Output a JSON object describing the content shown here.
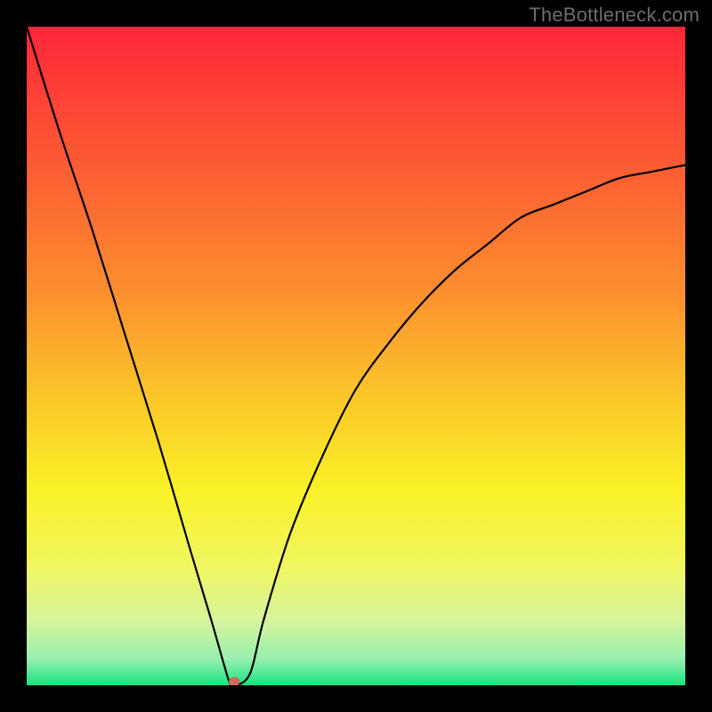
{
  "watermark": "TheBottleneck.com",
  "colors": {
    "gradient_stops": [
      {
        "offset": 0.0,
        "color": "#fe2639"
      },
      {
        "offset": 0.2,
        "color": "#fd5933"
      },
      {
        "offset": 0.4,
        "color": "#fc8e2f"
      },
      {
        "offset": 0.55,
        "color": "#fbc22a"
      },
      {
        "offset": 0.7,
        "color": "#faf126"
      },
      {
        "offset": 0.82,
        "color": "#f0f661"
      },
      {
        "offset": 0.9,
        "color": "#d7f49a"
      },
      {
        "offset": 0.96,
        "color": "#98efb1"
      },
      {
        "offset": 1.0,
        "color": "#18e480"
      }
    ],
    "curve": "#000000",
    "dot": "#d36a5e",
    "frame": "#000000"
  },
  "chart_data": {
    "type": "line",
    "title": "",
    "xlabel": "",
    "ylabel": "",
    "xlim": [
      0,
      100
    ],
    "ylim": [
      0,
      100
    ],
    "grid": false,
    "legend": false,
    "series": [
      {
        "name": "bottleneck-v-curve",
        "x": [
          0,
          5,
          10,
          15,
          20,
          25,
          28,
          30,
          31,
          32,
          34,
          36,
          40,
          45,
          50,
          55,
          60,
          65,
          70,
          75,
          80,
          85,
          90,
          95,
          100
        ],
        "y": [
          100,
          84,
          69,
          53,
          37,
          20,
          10,
          3,
          0,
          0,
          2,
          10,
          23,
          35,
          45,
          52,
          58,
          63,
          67,
          71,
          73,
          75,
          77,
          78,
          79
        ]
      }
    ],
    "annotations": [
      {
        "type": "point",
        "name": "minimum-marker",
        "x": 31.5,
        "y": 0,
        "color": "#d36a5e"
      }
    ]
  }
}
